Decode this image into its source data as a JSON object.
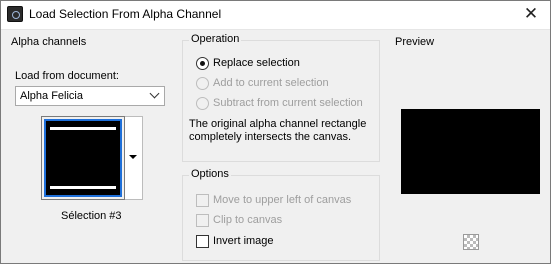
{
  "window": {
    "title": "Load Selection From Alpha Channel",
    "icon": "app-icon",
    "close_symbol": "✕"
  },
  "alpha_channels": {
    "title": "Alpha channels",
    "load_from_label": "Load from document:",
    "document_value": "Alpha Felicia",
    "selection_name": "Sélection #3"
  },
  "operation": {
    "title": "Operation",
    "options": [
      {
        "label": "Replace selection",
        "checked": true,
        "enabled": true
      },
      {
        "label": "Add to current selection",
        "checked": false,
        "enabled": false
      },
      {
        "label": "Subtract from current selection",
        "checked": false,
        "enabled": false
      }
    ],
    "info_text": "The original alpha channel rectangle completely intersects the canvas."
  },
  "options": {
    "title": "Options",
    "items": [
      {
        "label": "Move to upper left of canvas",
        "checked": false,
        "enabled": false
      },
      {
        "label": "Clip to canvas",
        "checked": false,
        "enabled": false
      },
      {
        "label": "Invert image",
        "checked": false,
        "enabled": true
      }
    ]
  },
  "preview": {
    "title": "Preview",
    "transparency_icon": "checkerboard-icon"
  }
}
